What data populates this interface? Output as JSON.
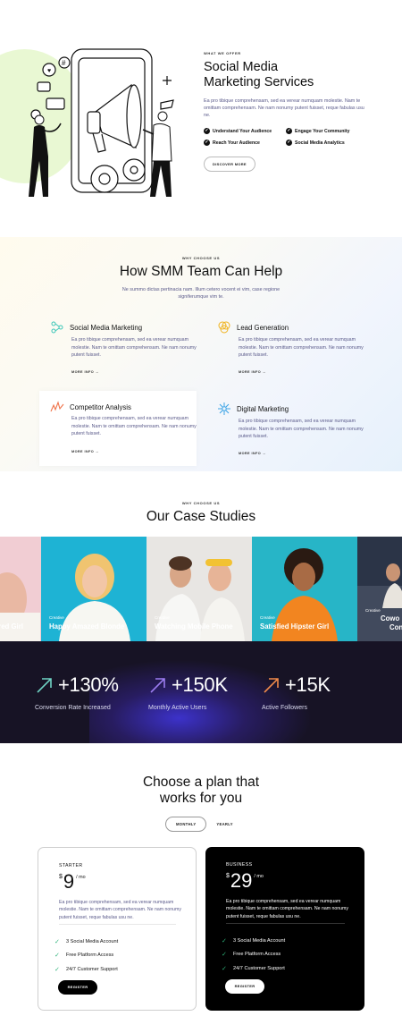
{
  "hero": {
    "eyebrow": "WHAT WE OFFER",
    "title_line1": "Social Media",
    "title_line2": "Marketing Services",
    "description": "Ea pro tibique comprehensam, sed ea verear numquam molestie. Nam te omittam comprehensam. Ne nam nonumy putent fuisset, reque fabulas usu ne.",
    "features": [
      "Understand Your Audience",
      "Engage Your Community",
      "Reach Your Audience",
      "Social Media Analytics"
    ],
    "button_label": "DISCOVER MORE"
  },
  "help": {
    "eyebrow": "WHY CHOOSE US",
    "title": "How SMM Team Can Help",
    "subtitle": "Ne summo dictas pertinacia nam. Illum cetero vocent ei vim, case regione signiferumque vim te.",
    "services": [
      {
        "title": "Social Media Marketing",
        "description": "Ea pro tibique comprehensam, sed ea verear numquam molestie. Nam te omittam comprehensam. Ne nam nonumy putent fuisset.",
        "more": "MORE INFO",
        "icon": "network-icon"
      },
      {
        "title": "Lead Generation",
        "description": "Ea pro tibique comprehensam, sed ea verear numquam molestie. Nam te omittam comprehensam. Ne nam nonumy putent fuisset.",
        "more": "MORE INFO",
        "icon": "circles-icon"
      },
      {
        "title": "Competitor Analysis",
        "description": "Ea pro tibique comprehensam, sed ea verear numquam molestie. Nam te omittam comprehensam. Ne nam nonumy putent fuisset.",
        "more": "MORE INFO",
        "icon": "zigzag-icon"
      },
      {
        "title": "Digital Marketing",
        "description": "Ea pro tibique comprehensam, sed ea verear numquam molestie. Nam te omittam comprehensam. Ne nam nonumy putent fuisset.",
        "more": "MORE INFO",
        "icon": "snowflake-icon"
      }
    ]
  },
  "cases": {
    "eyebrow": "WHY CHOOSE US",
    "title": "Our Case Studies",
    "items": [
      {
        "category": "",
        "name": "ired Girl"
      },
      {
        "category": "Creative",
        "name": "Happy Amazed Blonde"
      },
      {
        "category": "Creative",
        "name": "Watching Mobile Phone"
      },
      {
        "category": "Creative",
        "name": "Satisfied Hipster Girl"
      },
      {
        "category": "Creative",
        "name": "Cowo"
      },
      {
        "category": "",
        "name": "Con"
      }
    ]
  },
  "stats": [
    {
      "value": "+130%",
      "label": "Conversion Rate Increased",
      "color": "#6fd3c4"
    },
    {
      "value": "+150K",
      "label": "Monthly Active Users",
      "color": "#9b7cf0"
    },
    {
      "value": "+15K",
      "label": "Active Followers",
      "color": "#f08a4b"
    }
  ],
  "pricing": {
    "title_line1": "Choose a plan that",
    "title_line2": "works for you",
    "toggle": {
      "monthly": "MONTHLY",
      "yearly": "YEARLY"
    },
    "plans": [
      {
        "name": "STARTER",
        "currency": "$",
        "amount": "9",
        "period": "/ mo",
        "description": "Ea pro tibique comprehensam, sed ea verear numquam molestie. Nam te omittam comprehensam. Ne nam nonumy putent fuisset, reque fabulas usu ne.",
        "features": [
          "3 Social Media Account",
          "Free Platform Access",
          "24/7 Customer Support"
        ],
        "button": "REGISTER"
      },
      {
        "name": "BUSINESS",
        "currency": "$",
        "amount": "29",
        "period": "/ mo",
        "description": "Ea pro tibique comprehensam, sed ea verear numquam molestie. Nam te omittam comprehensam. Ne nam nonumy putent fuisset, reque fabulas usu ne.",
        "features": [
          "3 Social Media Account",
          "Free Platform Access",
          "24/7 Customer Support"
        ],
        "button": "REGISTER"
      }
    ]
  }
}
